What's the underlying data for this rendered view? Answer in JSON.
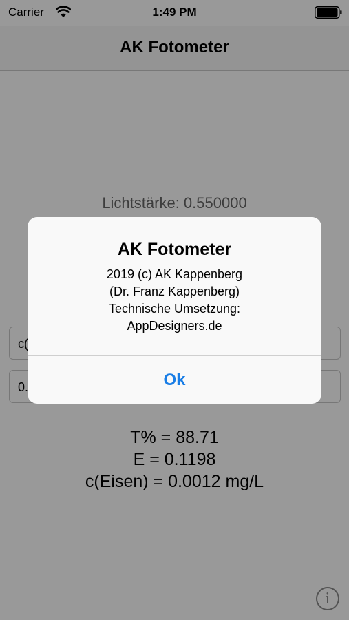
{
  "status_bar": {
    "carrier": "Carrier",
    "time": "1:49 PM"
  },
  "nav": {
    "title": "AK Fotometer"
  },
  "main": {
    "intensity": "Lichtstärke: 0.550000",
    "field1_value": "c(",
    "field2_value": "0.",
    "results": [
      "T% = 88.71",
      "E = 0.1198",
      "c(Eisen) = 0.0012 mg/L"
    ],
    "info_label": "i"
  },
  "alert": {
    "title": "AK Fotometer",
    "message": [
      "2019 (c) AK Kappenberg",
      "(Dr. Franz Kappenberg)",
      "Technische Umsetzung:",
      "AppDesigners.de"
    ],
    "ok_label": "Ok"
  },
  "colors": {
    "accent": "#1a7ee6",
    "overlay": "rgba(0,0,0,0.4)"
  },
  "icons": [
    "wifi-icon",
    "battery-icon",
    "info-icon"
  ]
}
